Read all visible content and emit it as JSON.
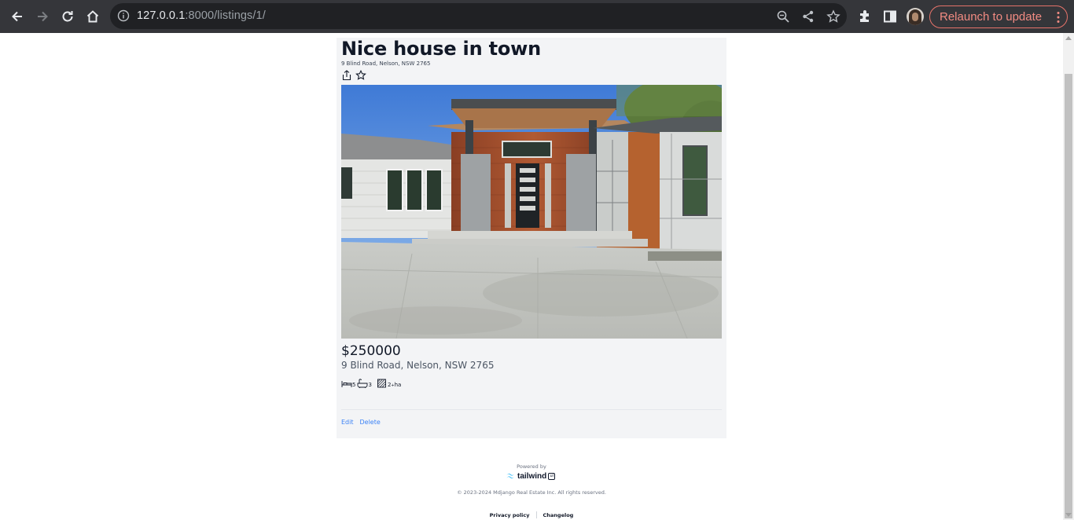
{
  "browser": {
    "url_host": "127.0.0.1",
    "url_rest": ":8000/listings/1/",
    "relaunch_label": "Relaunch to update",
    "icons": [
      "back-icon",
      "forward-icon",
      "reload-icon",
      "home-icon",
      "info-icon",
      "zoom-icon",
      "share-icon",
      "bookmark-star-icon",
      "extensions-icon",
      "side-panel-icon",
      "profile-avatar",
      "menu-dots-icon"
    ]
  },
  "listing": {
    "title": "Nice house in town",
    "subaddress": "9 Blind Road, Nelson, NSW 2765",
    "price": "$250000",
    "address": "9 Blind Road, Nelson, NSW 2765",
    "bedrooms": "5",
    "bathrooms": "3",
    "land_size": "2",
    "land_unit_sup": "+",
    "land_unit": "ha",
    "actions": {
      "edit_label": "Edit",
      "delete_label": "Delete"
    },
    "icons": [
      "share-icon",
      "favorite-star-icon",
      "bed-icon",
      "bath-icon",
      "land-area-icon"
    ]
  },
  "footer": {
    "powered_by": "Powered by",
    "brand": "tailwind",
    "brand_badge": "ui",
    "copyright": "© 2023-2024 Mdjango Real Estate Inc. All rights reserved.",
    "privacy_label": "Privacy policy",
    "changelog_label": "Changelog"
  },
  "colors": {
    "chrome_bg": "#35363a",
    "omnibox_bg": "#202124",
    "relaunch_accent": "#f28b82",
    "card_bg": "#f3f4f6",
    "link_blue": "#3b82f6"
  }
}
